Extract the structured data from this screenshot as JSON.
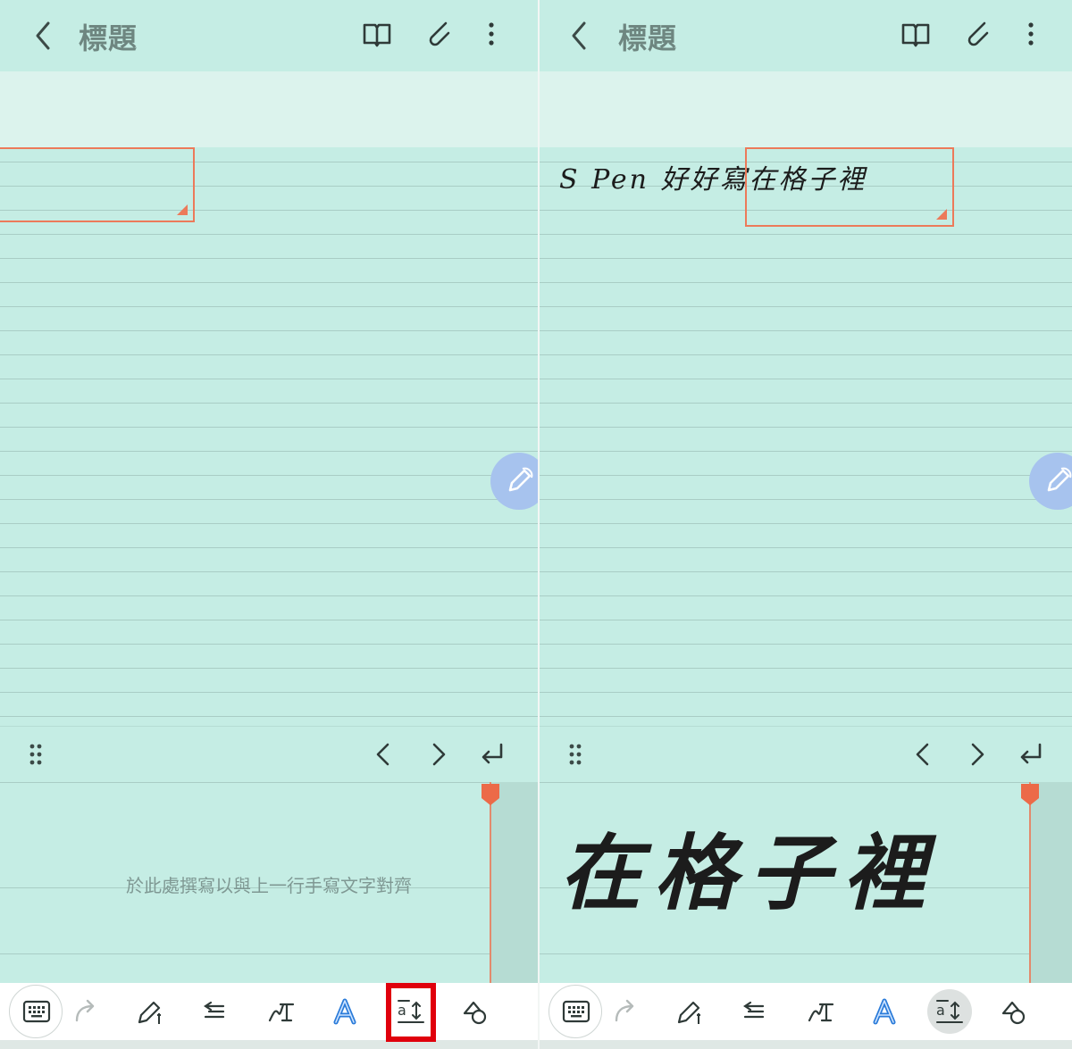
{
  "left": {
    "appbar": {
      "title": "標題"
    },
    "handwriting": {
      "hint": "於此處撰寫以與上一行手寫文字對齊"
    }
  },
  "right": {
    "appbar": {
      "title": "標題"
    },
    "note_text": "S Pen 好好寫在格子裡",
    "handwriting_text": "在格子裡"
  },
  "toolbar_icons": [
    "keyboard-icon",
    "redo-icon",
    "pen-icon",
    "align-icon",
    "pen-to-text-icon",
    "text-style-icon",
    "text-align-icon",
    "shape-icon"
  ],
  "colors": {
    "accent": "#ec7a5a",
    "highlight": "#e0000c",
    "background": "#c5ede4"
  }
}
